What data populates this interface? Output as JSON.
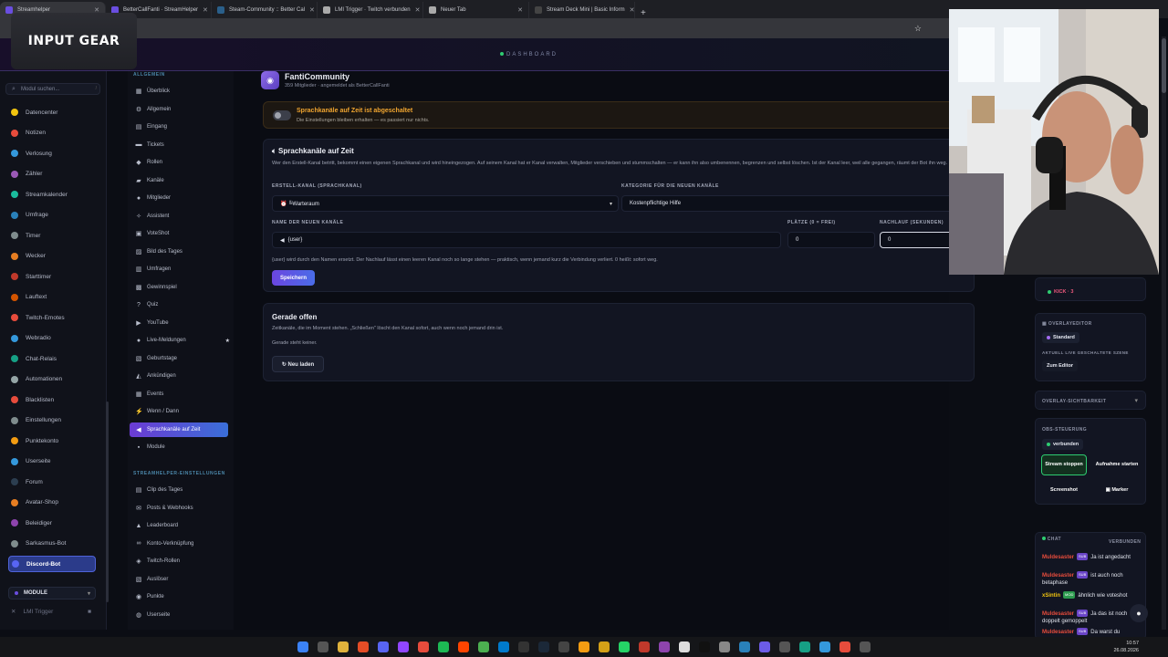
{
  "browser": {
    "tabs": [
      {
        "label": "Streamhelper",
        "icon": "sh-icon",
        "color": "#6a4ee0"
      },
      {
        "label": "BetterCallFanti · StreamHelper",
        "icon": "sh-icon",
        "color": "#6a4ee0"
      },
      {
        "label": "Steam-Community :: Better Cal",
        "icon": "steam-icon",
        "color": "#2a5f8a"
      },
      {
        "label": "LMI Trigger · Twitch verbunden",
        "icon": "lmi-icon",
        "color": "#aaaaaa"
      },
      {
        "label": "Neuer Tab",
        "icon": "newtab-icon",
        "color": "#aaaaaa"
      },
      {
        "label": "Stream Deck Mini | Basic Inform",
        "icon": "elgato-icon",
        "color": "#444444"
      }
    ],
    "new_tab": "+"
  },
  "overlay_logo": "INPUT GEAR",
  "header": {
    "title": "DASHBOARD"
  },
  "left_sidebar": {
    "search_placeholder": "Modul suchen...",
    "search_shortcut": "/",
    "items": [
      {
        "label": "Datencenter",
        "color": "#f1c40f"
      },
      {
        "label": "Notizen",
        "color": "#e74c3c"
      },
      {
        "label": "Verlosung",
        "color": "#3498db"
      },
      {
        "label": "Zähler",
        "color": "#9b59b6"
      },
      {
        "label": "Streamkalender",
        "color": "#1abc9c"
      },
      {
        "label": "Umfrage",
        "color": "#2980b9"
      },
      {
        "label": "Timer",
        "color": "#7f8c8d"
      },
      {
        "label": "Wecker",
        "color": "#e67e22"
      },
      {
        "label": "Starttimer",
        "color": "#c0392b"
      },
      {
        "label": "Lauftext",
        "color": "#d35400"
      },
      {
        "label": "Twitch-Emotes",
        "color": "#e74c3c"
      },
      {
        "label": "Webradio",
        "color": "#3498db"
      },
      {
        "label": "Chat-Relais",
        "color": "#16a085"
      },
      {
        "label": "Automationen",
        "color": "#95a5a6"
      },
      {
        "label": "Blacklisten",
        "color": "#e74c3c"
      },
      {
        "label": "Einstellungen",
        "color": "#7f8c8d"
      },
      {
        "label": "Punktekonto",
        "color": "#f39c12"
      },
      {
        "label": "Userseite",
        "color": "#3498db"
      },
      {
        "label": "Forum",
        "color": "#2c3e50"
      },
      {
        "label": "Avatar-Shop",
        "color": "#e67e22"
      },
      {
        "label": "Beleidiger",
        "color": "#8e44ad"
      },
      {
        "label": "Sarkasmus-Bot",
        "color": "#7f8c8d"
      },
      {
        "label": "Discord-Bot",
        "color": "#5865f2"
      }
    ],
    "modul_header": "MODULE",
    "lmi_item": "LMI Trigger"
  },
  "module_sidebar": {
    "section1": "ALLGEMEIN",
    "items1": [
      {
        "label": "Überblick",
        "glyph": "▦"
      },
      {
        "label": "Allgemein",
        "glyph": "⚙"
      },
      {
        "label": "Eingang",
        "glyph": "▤"
      },
      {
        "label": "Tickets",
        "glyph": "▬"
      },
      {
        "label": "Rollen",
        "glyph": "◆"
      },
      {
        "label": "Kanäle",
        "glyph": "▰"
      },
      {
        "label": "Mitglieder",
        "glyph": "●"
      },
      {
        "label": "Assistent",
        "glyph": "✧"
      },
      {
        "label": "VoteShot",
        "glyph": "▣"
      },
      {
        "label": "Bild des Tages",
        "glyph": "▨"
      },
      {
        "label": "Umfragen",
        "glyph": "▥"
      },
      {
        "label": "Gewinnspiel",
        "glyph": "▩"
      },
      {
        "label": "Quiz",
        "glyph": "?"
      },
      {
        "label": "YouTube",
        "glyph": "▶"
      },
      {
        "label": "Live-Meldungen",
        "glyph": "●"
      },
      {
        "label": "Geburtstage",
        "glyph": "▧"
      },
      {
        "label": "Ankündigen",
        "glyph": "◭"
      },
      {
        "label": "Events",
        "glyph": "▦"
      },
      {
        "label": "Wenn / Dann",
        "glyph": "⚡"
      },
      {
        "label": "Sprachkanäle auf Zeit",
        "glyph": "◀"
      },
      {
        "label": "Module",
        "glyph": "▪"
      }
    ],
    "section2": "STREAMHELPER-EINSTELLUNGEN",
    "items2": [
      {
        "label": "Clip des Tages",
        "glyph": "▤"
      },
      {
        "label": "Posts & Webhooks",
        "glyph": "✉"
      },
      {
        "label": "Leaderboard",
        "glyph": "▲"
      },
      {
        "label": "Konto-Verknüpfung",
        "glyph": "∞"
      },
      {
        "label": "Twitch-Rollen",
        "glyph": "◈"
      },
      {
        "label": "Auslöser",
        "glyph": "▧"
      },
      {
        "label": "Punkte",
        "glyph": "◉"
      },
      {
        "label": "Userseite",
        "glyph": "◍"
      }
    ]
  },
  "main": {
    "community_name": "FantiCommunity",
    "community_desc": "359 Mitglieder · angemeldet als BetterCallFanti",
    "warning_title": "Sprachkanäle auf Zeit ist abgeschaltet",
    "warning_desc": "Die Einstellungen bleiben erhalten — es passiert nur nichts.",
    "config_title": "Sprachkanäle auf Zeit",
    "config_desc": "Wer den Erstell-Kanal betritt, bekommt einen eigenen Sprachkanal und wird hineingezogen. Auf seinem Kanal hat er Kanal verwalten, Mitglieder verschieben und stummschalten — er kann ihn also umbenennen, begrenzen und selbst löschen. Ist der Kanal leer, weil alle gegangen, räumt der Bot ihn weg.",
    "create_channel_label": "ERSTELL-KANAL (SPRACHKANAL)",
    "create_channel_value": "⏰ ╚Warteraum",
    "category_label": "KATEGORIE FÜR DIE NEUEN KANÄLE",
    "category_value": "Kostenpflichtige Hilfe",
    "name_label": "NAME DER NEUEN KANÄLE",
    "name_value": "{user}",
    "slots_label": "PLÄTZE (0 = FREI)",
    "slots_value": "0",
    "delay_label": "NACHLAUF (SEKUNDEN)",
    "delay_value": "0",
    "note": "{user} wird durch den Namen ersetzt. Der Nachlauf lässt einen leeren Kanal noch so lange stehen — praktisch, wenn jemand kurz die Verbindung verliert. 0 heißt: sofort weg.",
    "save_label": "Speichern",
    "open_title": "Gerade offen",
    "open_desc": "Zeitkanäle, die im Moment stehen. „Schließen\" löscht den Kanal sofort, auch wenn noch jemand drin ist.",
    "open_empty": "Gerade steht keiner.",
    "reload_label": "↻ Neu laden"
  },
  "right_panel": {
    "kick_label": "KICK · 3",
    "overlay_editor_label": "OVERLAYEDITOR",
    "overlay_editor_value": "Standard",
    "scene_label": "AKTUELL LIVE GESCHALTETE SZENE",
    "editor_button": "Zum Editor",
    "overlay_visibility": "OVERLAY-SICHTBARKEIT",
    "obs_label": "OBS-STEUERUNG",
    "obs_status": "verbunden",
    "stream_stop": "Stream stoppen",
    "record_start": "Aufnahme starten",
    "screenshot": "Screenshot",
    "marker": "Marker",
    "chat_label": "CHAT",
    "chat_status": "VERBUNDEN",
    "chat": [
      {
        "user": "Muldesaster",
        "badge": "SUB",
        "text": "Ja ist angedacht",
        "color": "#e74c3c"
      },
      {
        "user": "Muldesaster",
        "badge": "SUB",
        "text": "ist auch noch betaphase",
        "color": "#e74c3c"
      },
      {
        "user": "xSintin",
        "badge": "MOD",
        "text": "ähnlich wie voteshot",
        "color": "#f1c40f"
      },
      {
        "user": "Muldesaster",
        "badge": "SUB",
        "text": "Ja das ist noch doppelt gemoppelt",
        "color": "#e74c3c"
      },
      {
        "user": "Muldesaster",
        "badge": "SUB",
        "text": "Da warst du",
        "color": "#e74c3c"
      }
    ]
  },
  "taskbar": {
    "time": "10:57",
    "date": "26.08.2026"
  }
}
